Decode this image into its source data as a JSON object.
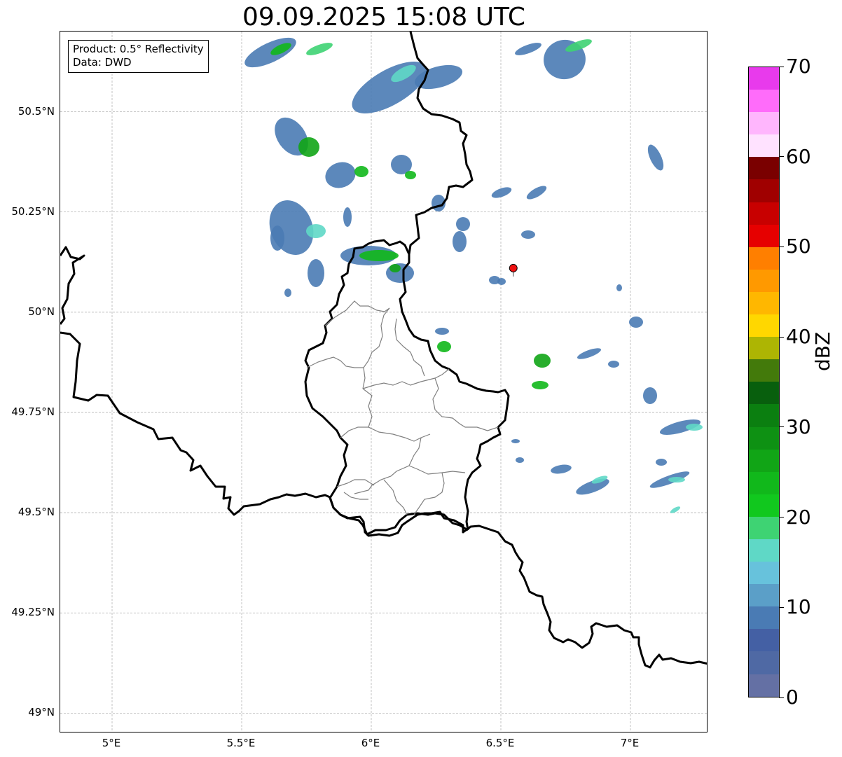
{
  "title": "09.09.2025 15:08 UTC",
  "info": {
    "product": "Product: 0.5° Reflectivity",
    "data": "Data: DWD"
  },
  "map": {
    "extent_lon": [
      4.8,
      7.3
    ],
    "extent_lat": [
      48.95,
      50.7
    ],
    "lat_ticks": [
      {
        "value": 50.5,
        "label": "50.5°N"
      },
      {
        "value": 50.25,
        "label": "50.25°N"
      },
      {
        "value": 50.0,
        "label": "50°N"
      },
      {
        "value": 49.75,
        "label": "49.75°N"
      },
      {
        "value": 49.5,
        "label": "49.5°N"
      },
      {
        "value": 49.25,
        "label": "49.25°N"
      },
      {
        "value": 49.0,
        "label": "49°N"
      }
    ],
    "lon_ticks": [
      {
        "value": 5.0,
        "label": "5°E"
      },
      {
        "value": 5.5,
        "label": "5.5°E"
      },
      {
        "value": 6.0,
        "label": "6°E"
      },
      {
        "value": 6.5,
        "label": "6.5°E"
      },
      {
        "value": 7.0,
        "label": "7°E"
      }
    ],
    "radar_marker": {
      "lon": 6.548,
      "lat": 50.11,
      "color": "#ee1111"
    },
    "gridlines": true
  },
  "colorbar": {
    "unit": "dBZ",
    "min": 0,
    "max": 70,
    "tick_labels": [
      "0",
      "10",
      "20",
      "30",
      "40",
      "50",
      "60",
      "70"
    ],
    "colors": [
      "#6470a4",
      "#4f69a4",
      "#4460a4",
      "#4a7bb4",
      "#5b9fc8",
      "#67c2dc",
      "#5fd8c6",
      "#3ed373",
      "#11c81e",
      "#11b81b",
      "#11a516",
      "#0e9113",
      "#0b7f10",
      "#085f0d",
      "#437a0b",
      "#adb503",
      "#ffd700",
      "#ffb700",
      "#ff9900",
      "#ff7f00",
      "#e60000",
      "#c80000",
      "#a00000",
      "#7a0000",
      "#ffe2ff",
      "#ffb6fd",
      "#ff6cfa",
      "#e83aec"
    ]
  }
}
